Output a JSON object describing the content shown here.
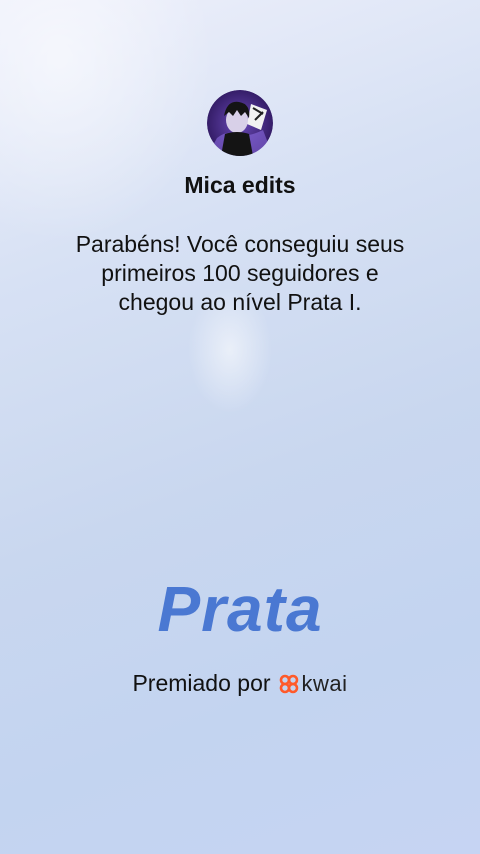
{
  "profile": {
    "name": "Mica edits",
    "avatar_icon": "avatar-icon"
  },
  "message": {
    "lines": [
      "Parabéns! Você conseguiu seus",
      "primeiros 100 seguidores e",
      "chegou ao nível Prata I."
    ]
  },
  "badge": {
    "title": "Prata",
    "color": "#4a78d2"
  },
  "award": {
    "label": "Premiado por",
    "brand": "kwai",
    "brand_color": "#ff5a2a",
    "brand_icon": "kwai-logo-icon"
  }
}
